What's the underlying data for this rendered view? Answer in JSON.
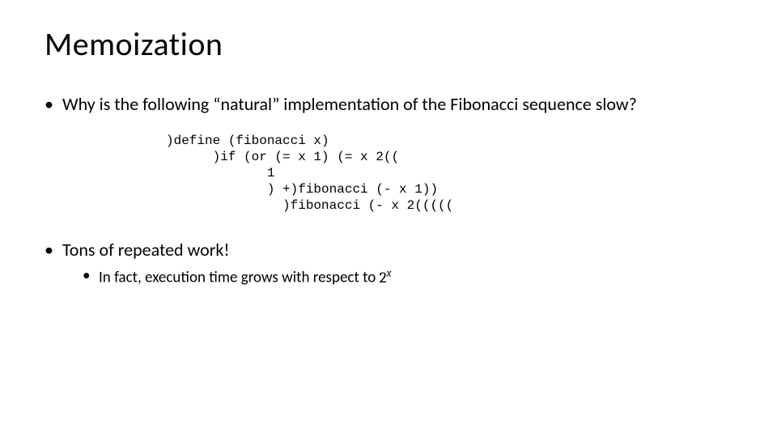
{
  "title": "Memoization",
  "bullet1": "Why is the following “natural” implementation of the Fibonacci sequence slow?",
  "code": ")define (fibonacci x)\n      )if (or (= x 1) (= x 2((\n             1\n             ) +)fibonacci (- x 1))\n               )fibonacci (- x 2(((((",
  "bullet2": "Tons of repeated work!",
  "sub1_prefix": "In fact, execution time grows with respect to ",
  "expo_base": "2",
  "expo_sup": "x"
}
